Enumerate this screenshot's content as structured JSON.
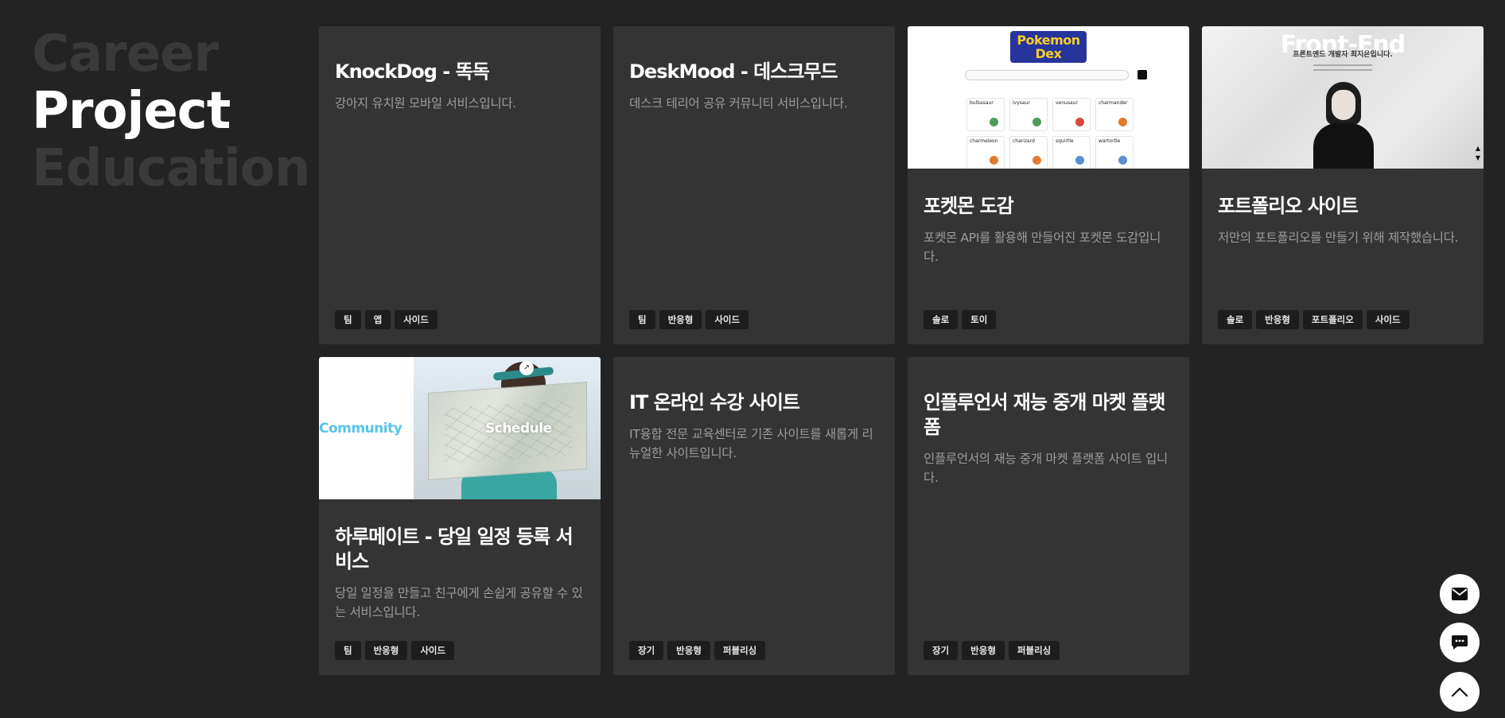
{
  "nav": {
    "items": [
      {
        "label": "Career",
        "active": false
      },
      {
        "label": "Project",
        "active": true
      },
      {
        "label": "Education",
        "active": false
      }
    ]
  },
  "cards": [
    {
      "title": "KnockDog - 똑독",
      "desc": "강아지 유치원 모바일 서비스입니다.",
      "tags": [
        "팀",
        "앱",
        "사이드"
      ]
    },
    {
      "title": "DeskMood - 데스크무드",
      "desc": "데스크 테리어 공유 커뮤니티 서비스입니다.",
      "tags": [
        "팀",
        "반응형",
        "사이드"
      ]
    },
    {
      "title": "포켓몬 도감",
      "desc": "포켓몬 API를 활용해 만들어진 포켓몬 도감입니다.",
      "tags": [
        "솔로",
        "토이"
      ],
      "thumb": {
        "logo_line1": "Pokemon",
        "logo_line2": "Dex",
        "pokemon": [
          "bulbasaur",
          "ivysaur",
          "venusaur",
          "charmander",
          "charmeleon",
          "charizard",
          "squirtle",
          "wartortle"
        ]
      }
    },
    {
      "title": "포트폴리오 사이트",
      "desc": "저만의 포트폴리오를 만들기 위해 제작했습니다.",
      "tags": [
        "솔로",
        "반응형",
        "포트폴리오",
        "사이드"
      ],
      "thumb": {
        "heading": "Front-End",
        "subheading": "프론트엔드 개발자 최지은입니다."
      }
    },
    {
      "title": "하루메이트 - 당일 일정 등록 서비스",
      "desc": "당일 일정을 만들고 친구에게 손쉽게 공유할 수 있는 서비스입니다.",
      "tags": [
        "팀",
        "반응형",
        "사이드"
      ],
      "thumb": {
        "left_label": "Community",
        "right_label": "Schedule"
      }
    },
    {
      "title": "IT 온라인 수강 사이트",
      "desc": "IT융합 전문 교육센터로 기존 사이트를 새롭게 리뉴얼한 사이트입니다.",
      "tags": [
        "장기",
        "반응형",
        "퍼블리싱"
      ]
    },
    {
      "title": "인플루언서 재능 중개 마켓 플랫폼",
      "desc": "인플루언서의 재능 중개 마켓 플랫폼 사이트 입니다.",
      "tags": [
        "장기",
        "반응형",
        "퍼블리싱"
      ]
    }
  ],
  "fabs": {
    "icons": [
      "mail-icon",
      "chat-icon",
      "chevron-up-icon"
    ]
  },
  "colors": {
    "background": "#232323",
    "card": "#343434",
    "tag": "#1d1d1d",
    "nav_inactive": "#3a3a3a",
    "nav_active": "#ffffff"
  }
}
